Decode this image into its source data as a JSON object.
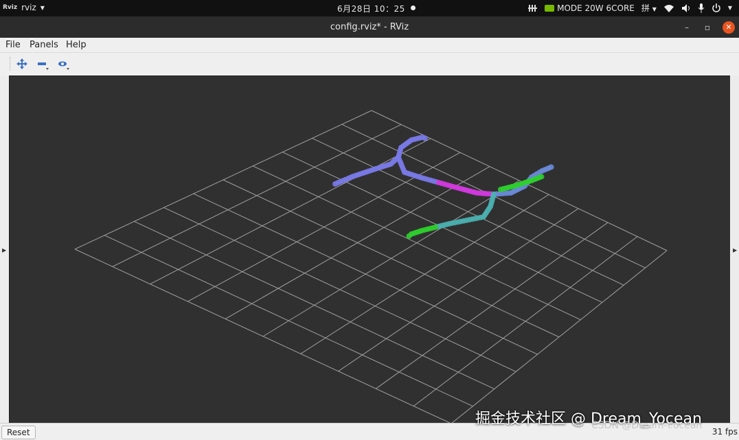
{
  "topbar": {
    "app_icon": "Rviz",
    "app_name": "rviz",
    "clock": "6月28日  10：25",
    "nvidia_mode": "MODE 20W 6CORE",
    "icons": [
      "grid-icon",
      "nvidia-icon",
      "input-method-icon",
      "wifi-icon",
      "volume-icon",
      "mic-icon",
      "power-icon"
    ]
  },
  "window": {
    "title": "config.rviz* - RViz",
    "min_glyph": "–",
    "max_glyph": "▫",
    "close_glyph": "✕"
  },
  "menu": {
    "file": "File",
    "panels": "Panels",
    "help": "Help"
  },
  "toolbar": {
    "tools": [
      "move-camera-icon",
      "select-icon",
      "focus-camera-icon"
    ]
  },
  "status": {
    "reset_label": "Reset",
    "fps": "31 fps"
  },
  "watermark": {
    "line1": "掘金技术社区 @ Dream_Yocean",
    "line2": "CSDN @Dream-Y.ocean"
  },
  "colors": {
    "viewport_bg": "#303030",
    "grid": "#a0a0a0",
    "accent_close": "#e95420",
    "nvidia_green": "#76b900",
    "traj_blue": "#7a7ae8",
    "traj_magenta": "#d43ae0",
    "traj_green": "#2fcf2f"
  }
}
